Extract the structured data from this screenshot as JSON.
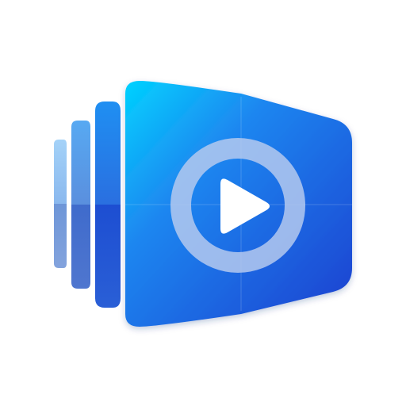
{
  "icon": {
    "name": "video-slideshow-app-icon",
    "glyph": "play-icon",
    "colors": {
      "background": "#ffffff",
      "panel_top": "#00d2ff",
      "panel_mid": "#1f74ec",
      "panel_bottom": "#1c48d0",
      "layer_light": "#9cc9f5",
      "layer_mid": "#5f8fd8",
      "layer_dark": "#2b5fd4",
      "ring": "#a9c3ef",
      "play": "#ffffff"
    }
  }
}
